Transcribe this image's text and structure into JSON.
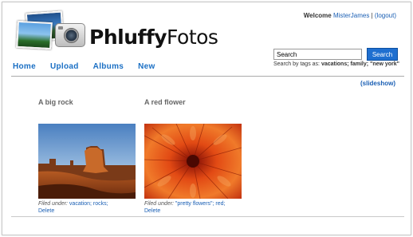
{
  "header": {
    "brand_bold": "Phluffy",
    "brand_light": "Fotos",
    "welcome_prefix": "Welcome",
    "username": "MisterJames",
    "separator": "|",
    "logout": "(logout)"
  },
  "nav": {
    "items": [
      {
        "label": "Home"
      },
      {
        "label": "Upload"
      },
      {
        "label": "Albums"
      },
      {
        "label": "New"
      }
    ]
  },
  "search": {
    "value": "Search",
    "button_label": "Search",
    "hint_prefix": "Search by tags as:",
    "hint_examples": "vacations; family; \"new york\""
  },
  "slideshow_link": "(slideshow)",
  "photos": [
    {
      "title": "A big rock",
      "filed_under_label": "Filed under:",
      "tags": "vacation; rocks;",
      "delete_label": "Delete"
    },
    {
      "title": "A red flower",
      "filed_under_label": "Filed under:",
      "tags": "\"pretty flowers\"; red;",
      "delete_label": "Delete"
    }
  ],
  "colors": {
    "link": "#1a5fb4",
    "nav": "#1a6fc4",
    "search_button": "#1f6fd0"
  }
}
